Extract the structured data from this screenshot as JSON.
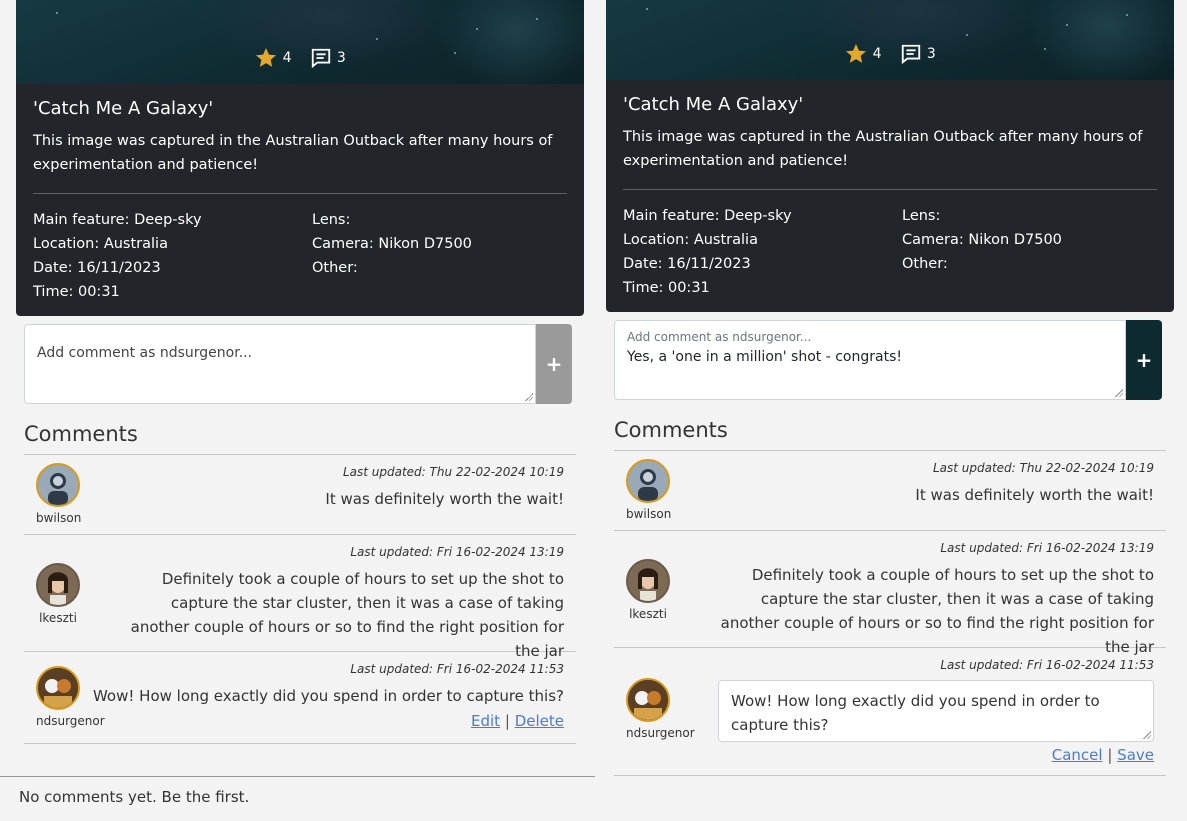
{
  "post": {
    "likes": "4",
    "comments_count": "3",
    "title": "'Catch Me A Galaxy'",
    "description": "This image was captured in the Australian Outback after many hours of experimentation and patience!",
    "main_feature": "Main feature: Deep-sky",
    "location": "Location: Australia",
    "date": "Date: 16/11/2023",
    "time": "Time: 00:31",
    "lens": "Lens:",
    "camera": "Camera: Nikon D7500",
    "other": "Other:"
  },
  "left": {
    "add_placeholder": "Add comment as ndsurgenor..."
  },
  "right": {
    "add_label": "Add comment as ndsurgenor...",
    "add_value": "Yes, a 'one in a million' shot - congrats!"
  },
  "add_button": "+",
  "comments_heading": "Comments",
  "comments": [
    {
      "user": "bwilson",
      "updated": "Last updated: Thu 22-02-2024 10:19",
      "text": "It was definitely worth the wait!"
    },
    {
      "user": "lkeszti",
      "updated": "Last updated: Fri 16-02-2024 13:19",
      "text": "Definitely took a couple of hours to set up the shot to capture the star cluster, then it was a case of taking another couple of hours or so to find the right position for the jar"
    },
    {
      "user": "ndsurgenor",
      "updated": "Last updated: Fri 16-02-2024 11:53",
      "text": "Wow! How long exactly did you spend in order to capture this?"
    }
  ],
  "actions": {
    "edit": "Edit",
    "delete": "Delete",
    "cancel": "Cancel",
    "save": "Save",
    "sep": "|"
  },
  "no_comments": "No comments yet. Be the first.",
  "colors": {
    "card_bg": "#22262b",
    "star": "#e5a92a",
    "accent_button": "#0d2a31",
    "link": "#4b7bd0",
    "avatar_ring": "#d69b1a"
  }
}
